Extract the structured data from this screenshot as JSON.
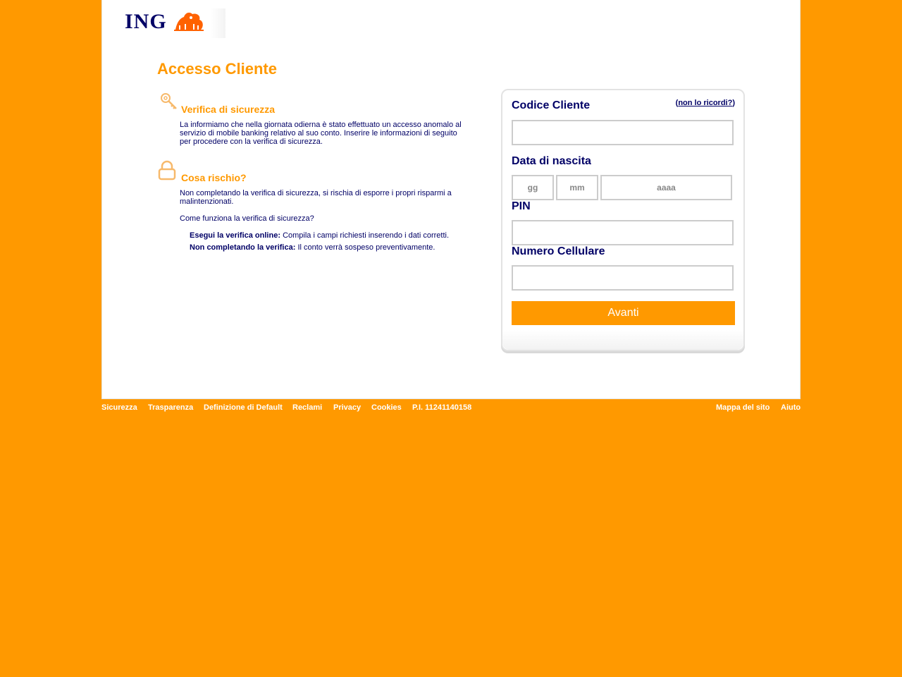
{
  "header": {
    "logo_text": "ING"
  },
  "main": {
    "title": "Accesso Cliente",
    "sections": [
      {
        "title": "Verifica di sicurezza",
        "text": "La informiamo che nella giornata odierna è stato effettuato un accesso anomalo al servizio di mobile banking relativo al suo conto. Inserire le informazioni di seguito per procedere con la verifica di sicurezza."
      },
      {
        "title": "Cosa rischio?",
        "text": "Non completando la verifica di sicurezza, si rischia di esporre i propri risparmi a malintenzionati.",
        "question": "Come funziona la verifica di sicurezza?",
        "items": [
          {
            "label": "Esegui la verifica online:",
            "text": "Compila i campi richiesti inserendo i dati corretti."
          },
          {
            "label": "Non completando la verifica:",
            "text": "Il conto verrà sospeso preventivamente."
          }
        ]
      }
    ]
  },
  "login": {
    "codice_label": "Codice Cliente",
    "forgot_link": "non lo ricordi?",
    "birth_label": "Data di nascita",
    "day_placeholder": "gg",
    "month_placeholder": "mm",
    "year_placeholder": "aaaa",
    "pin_label": "PIN",
    "phone_label": "Numero Cellulare",
    "submit_label": "Avanti"
  },
  "footer": {
    "links": [
      "Sicurezza",
      "Trasparenza",
      "Definizione di Default",
      "Reclami",
      "Privacy",
      "Cookies",
      "P.I. 11241140158"
    ],
    "right_links": [
      "Mappa del sito",
      "Aiuto"
    ]
  },
  "colors": {
    "brand_orange": "#ff9900",
    "brand_navy": "#000066"
  }
}
